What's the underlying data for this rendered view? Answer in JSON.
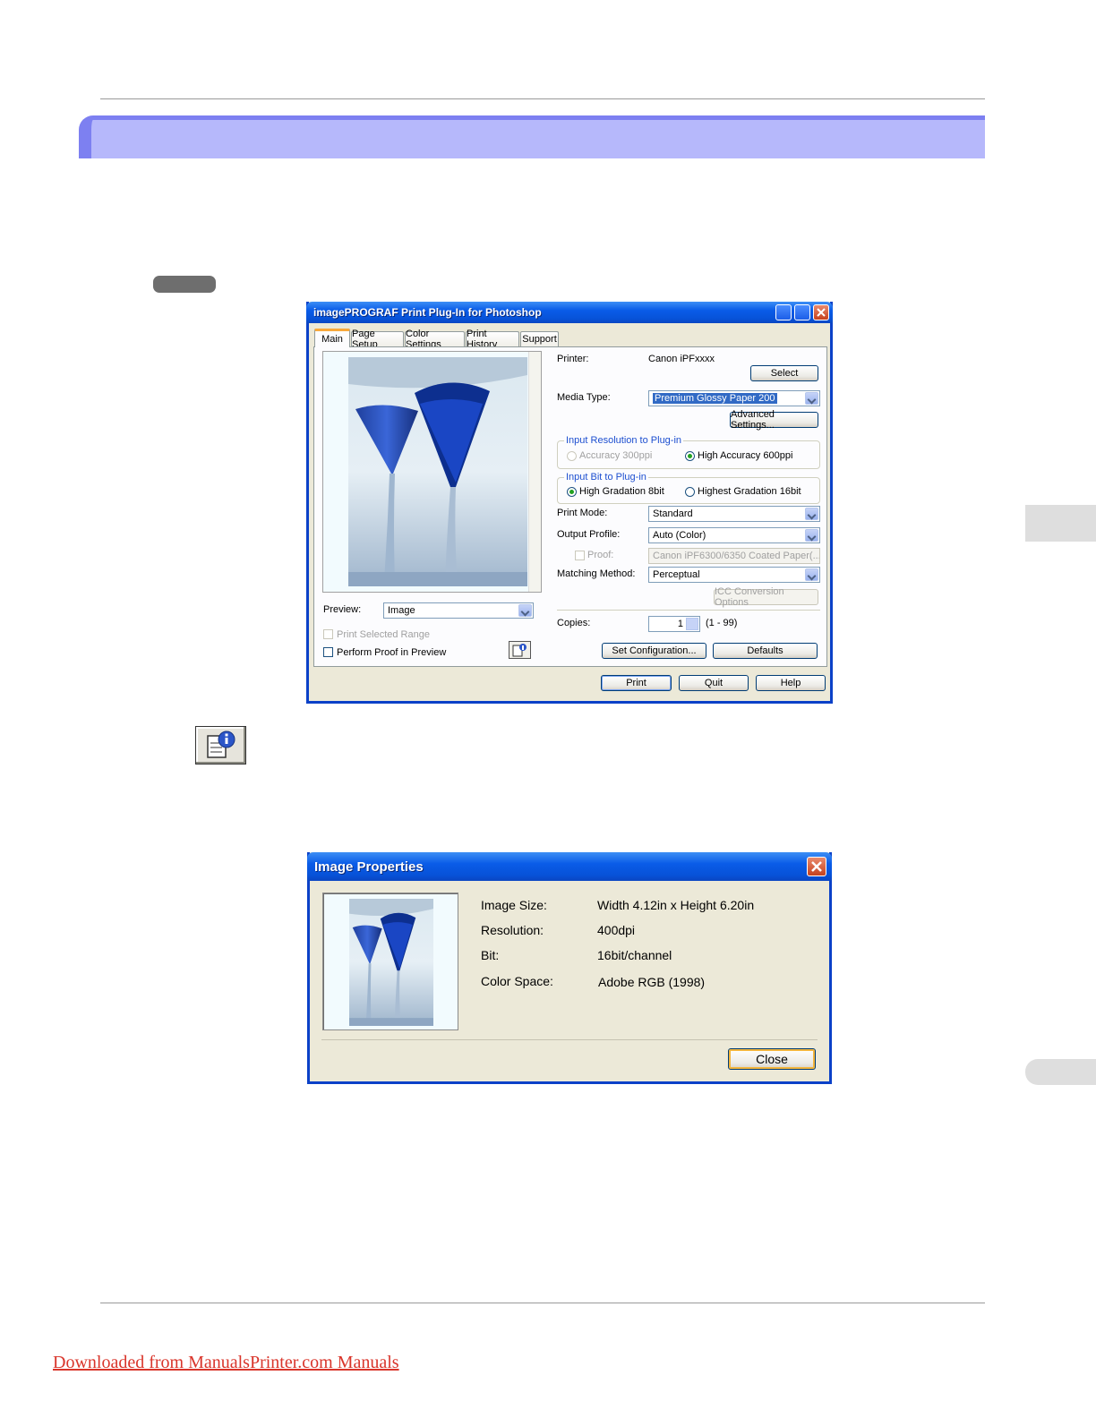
{
  "footer": {
    "link": "Downloaded from ManualsPrinter.com Manuals"
  },
  "plugin_dialog": {
    "title": "imagePROGRAF Print Plug-In for Photoshop",
    "tabs": [
      "Main",
      "Page Setup",
      "Color Settings",
      "Print History",
      "Support"
    ],
    "printer_label": "Printer:",
    "printer_value": "Canon iPFxxxx",
    "select_button": "Select",
    "media_type_label": "Media Type:",
    "media_type_value": "Premium Glossy Paper 200",
    "advanced_settings_button": "Advanced Settings...",
    "input_resolution_group": "Input Resolution to Plug-in",
    "accuracy_300": "Accuracy 300ppi",
    "accuracy_600": "High Accuracy 600ppi",
    "input_bit_group": "Input Bit to Plug-in",
    "gradation_8": "High Gradation 8bit",
    "gradation_16": "Highest Gradation 16bit",
    "print_mode_label": "Print Mode:",
    "print_mode_value": "Standard",
    "output_profile_label": "Output Profile:",
    "output_profile_value": "Auto (Color)",
    "proof_label": "Proof:",
    "proof_value": "Canon iPF6300/6350 Coated Paper(...",
    "matching_method_label": "Matching Method:",
    "matching_method_value": "Perceptual",
    "icc_button": "ICC Conversion Options",
    "copies_label": "Copies:",
    "copies_value": "1",
    "copies_range": "(1 - 99)",
    "set_configuration_button": "Set Configuration...",
    "defaults_button": "Defaults",
    "preview_label": "Preview:",
    "preview_value": "Image",
    "print_selected_range": "Print Selected Range",
    "perform_proof": "Perform Proof in Preview",
    "print_button": "Print",
    "quit_button": "Quit",
    "help_button": "Help"
  },
  "image_properties": {
    "title": "Image Properties",
    "rows": [
      {
        "label": "Image Size:",
        "value": "Width 4.12in x Height 6.20in"
      },
      {
        "label": "Resolution:",
        "value": "400dpi"
      },
      {
        "label": "Bit:",
        "value": "16bit/channel"
      },
      {
        "label": "Color Space:",
        "value": "Adobe RGB (1998)"
      }
    ],
    "close_button": "Close"
  }
}
